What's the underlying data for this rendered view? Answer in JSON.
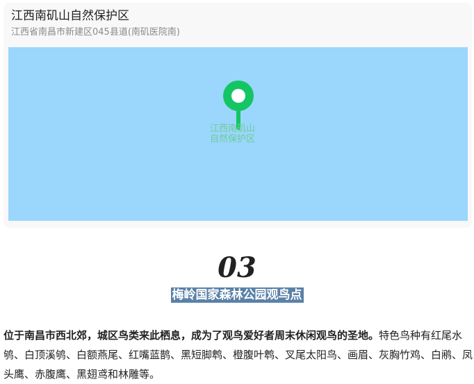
{
  "location": {
    "name": "江西南矶山自然保护区",
    "address": "江西省南昌市新建区045县道(南矶医院南)"
  },
  "map": {
    "label_line1": "江西南矶山",
    "label_line2": "自然保护区",
    "pin_icon": "map-pin-icon",
    "colors": {
      "water": "#9bd6fd",
      "pin": "#14c564"
    }
  },
  "section": {
    "number": "03",
    "title": "梅岭国家森林公园观鸟点",
    "title_bg": "#5a81a8"
  },
  "description": {
    "lead": "位于南昌市西北郊，城区鸟类来此栖息，成为了观鸟爱好者周末休闲观鸟的圣地。",
    "body": "特色鸟种有红尾水鸲、白顶溪鸲、白额燕尾、红嘴蓝鹊、黑短脚鹎、橙腹叶鹎、叉尾太阳鸟、画眉、灰胸竹鸡、白鹇、凤头鹰、赤腹鹰、黑翅鸢和林雕等。"
  }
}
